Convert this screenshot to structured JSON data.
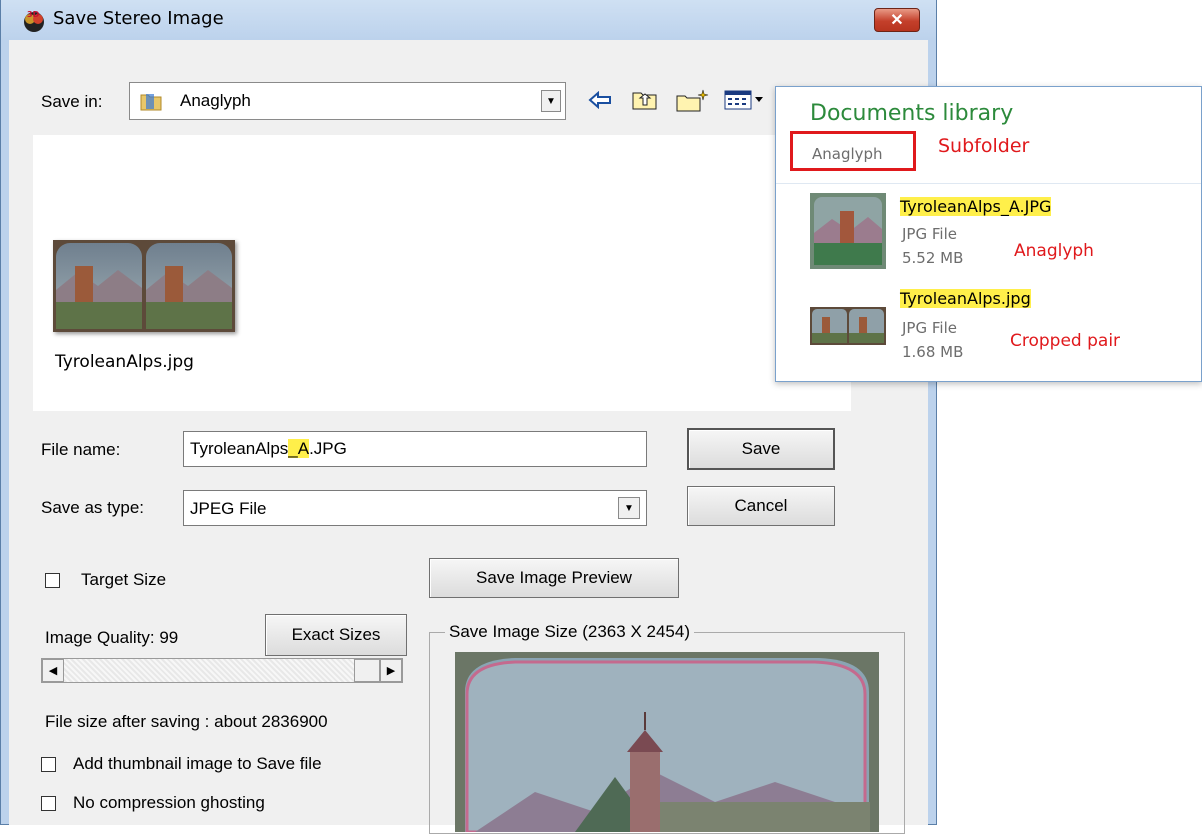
{
  "window": {
    "title": "Save Stereo Image",
    "close_glyph": "✕"
  },
  "save_in": {
    "label": "Save in:",
    "value": "Anaglyph",
    "dropdown_glyph": "▼"
  },
  "toolbar": {
    "back_icon": "back-arrow-icon",
    "up_icon": "up-folder-icon",
    "new_icon": "new-folder-icon",
    "view_icon": "view-menu-icon"
  },
  "preview": {
    "file_label": "TyroleanAlps.jpg"
  },
  "file_name": {
    "label": "File name:",
    "value_prefix": "TyroleanAlps",
    "value_highlight": "_A",
    "value_suffix": ".JPG"
  },
  "save_as_type": {
    "label": "Save as type:",
    "value": "JPEG File",
    "dropdown_glyph": "▼"
  },
  "buttons": {
    "save": "Save",
    "cancel": "Cancel",
    "save_preview": "Save Image Preview",
    "exact_sizes": "Exact Sizes"
  },
  "options": {
    "target_size": {
      "label": "Target Size",
      "checked": false
    },
    "quality_label": "Image Quality: 99",
    "file_size_text": "File size after saving : about 2836900",
    "thumbnail": {
      "label": "Add thumbnail image to Save file",
      "checked": false
    },
    "ghosting": {
      "label": "No compression ghosting",
      "checked": false
    }
  },
  "scrollbar": {
    "left_glyph": "◀",
    "right_glyph": "▶"
  },
  "save_image_size": {
    "label": "Save Image Size (2363 X 2454)"
  },
  "library": {
    "title": "Documents library",
    "subfolder": "Anaglyph",
    "subfolder_annotation": "Subfolder",
    "files": [
      {
        "name": "TyroleanAlps_A.JPG",
        "type": "JPG File",
        "size": "5.52 MB",
        "annotation": "Anaglyph"
      },
      {
        "name": "TyroleanAlps.jpg",
        "type": "JPG File",
        "size": "1.68 MB",
        "annotation": "Cropped pair"
      }
    ]
  },
  "colors": {
    "highlight": "#ffef4a",
    "annotation_red": "#e0191c",
    "library_green": "#2c8a3b",
    "window_frame": "#bcd2ec"
  }
}
